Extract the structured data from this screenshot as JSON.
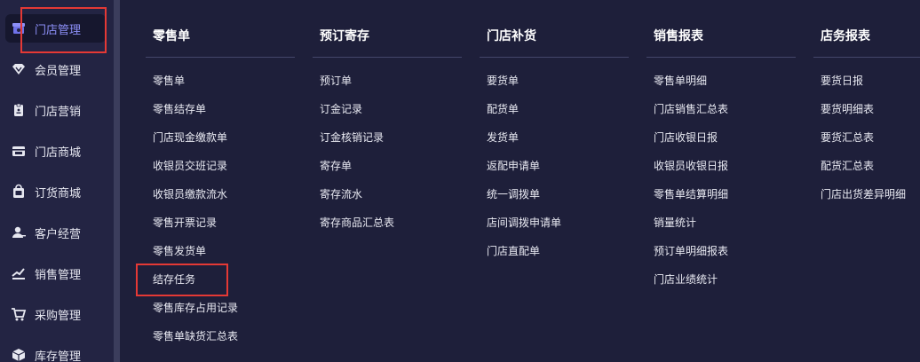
{
  "sidebar": {
    "items": [
      {
        "label": "门店管理",
        "icon": "store-icon",
        "active": true
      },
      {
        "label": "会员管理",
        "icon": "diamond-icon"
      },
      {
        "label": "门店营销",
        "icon": "clipboard-icon"
      },
      {
        "label": "门店商城",
        "icon": "shop-icon"
      },
      {
        "label": "订货商城",
        "icon": "shopping-bag-icon"
      },
      {
        "label": "客户经营",
        "icon": "user-icon"
      },
      {
        "label": "销售管理",
        "icon": "trend-icon"
      },
      {
        "label": "采购管理",
        "icon": "cart-icon"
      },
      {
        "label": "库存管理",
        "icon": "box-icon"
      }
    ]
  },
  "menu": {
    "columns": [
      {
        "title": "零售单",
        "items": [
          "零售单",
          "零售结存单",
          "门店现金缴款单",
          "收银员交班记录",
          "收银员缴款流水",
          "零售开票记录",
          "零售发货单",
          "结存任务",
          "零售库存占用记录",
          "零售单缺货汇总表"
        ]
      },
      {
        "title": "预订寄存",
        "items": [
          "预订单",
          "订金记录",
          "订金核销记录",
          "寄存单",
          "寄存流水",
          "寄存商品汇总表"
        ]
      },
      {
        "title": "门店补货",
        "items": [
          "要货单",
          "配货单",
          "发货单",
          "返配申请单",
          "统一调拨单",
          "店间调拨申请单",
          "门店直配单"
        ]
      },
      {
        "title": "销售报表",
        "items": [
          "零售单明细",
          "门店销售汇总表",
          "门店收银日报",
          "收银员收银日报",
          "零售单结算明细",
          "销量统计",
          "预订单明细报表",
          "门店业绩统计"
        ]
      },
      {
        "title": "店务报表",
        "items": [
          "要货日报",
          "要货明细表",
          "要货汇总表",
          "配货汇总表",
          "门店出货差异明细"
        ]
      }
    ]
  },
  "colors": {
    "sidebar_bg": "#232443",
    "menu_bg": "#1e1f3a",
    "active_text": "#8c8ff7",
    "highlight": "#e53935"
  }
}
